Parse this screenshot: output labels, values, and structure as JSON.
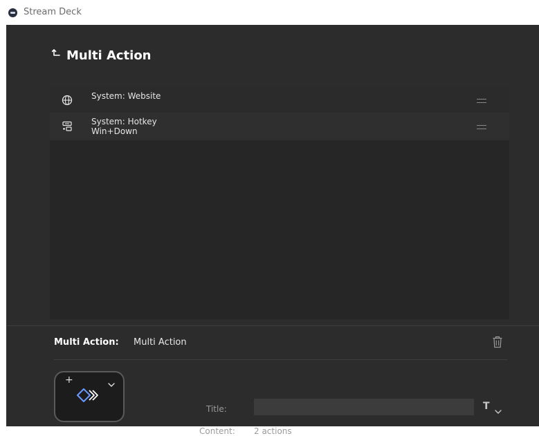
{
  "window": {
    "app_title": "Stream Deck"
  },
  "header": {
    "title": "Multi Action"
  },
  "actions": [
    {
      "label": "System: Website",
      "sub": "",
      "icon": "globe-icon"
    },
    {
      "label": "System: Hotkey",
      "sub": "Win+Down",
      "icon": "hotkey-icon"
    }
  ],
  "properties": {
    "label": "Multi Action:",
    "value": "Multi Action",
    "title_label": "Title:",
    "title_value": "",
    "content_label": "Content:",
    "content_value": "2 actions"
  },
  "colors": {
    "background": "#2c2c2c",
    "panel": "#262626",
    "accent": "#5b8def"
  }
}
